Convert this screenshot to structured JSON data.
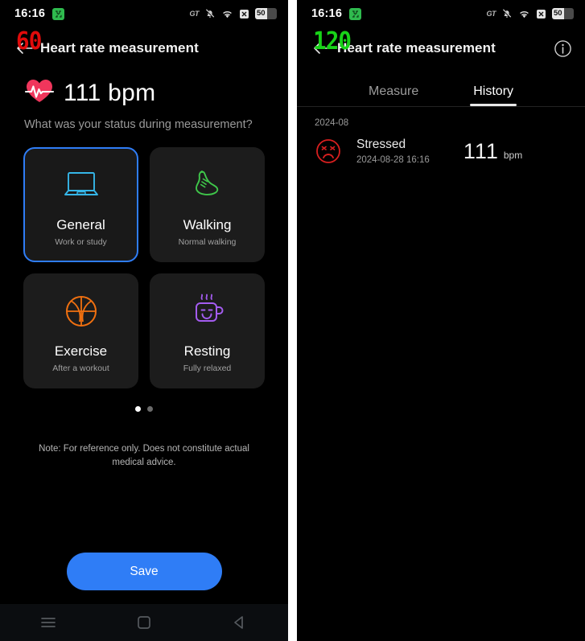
{
  "left": {
    "statusbar": {
      "time": "16:16",
      "badge_icon": "app-badge-icon",
      "carrier_label": "GT",
      "icons": [
        "bell-muted-icon",
        "wifi-icon",
        "sim-x-icon"
      ],
      "battery_level": "50"
    },
    "appbar": {
      "digital_readout": "60",
      "digital_color": "#e00b0b",
      "back_icon": "back-arrow-icon",
      "title": "Heart rate measurement"
    },
    "reading": {
      "heart_icon": "heart-pulse-icon",
      "value": "111 bpm",
      "question": "What was your status during measurement?"
    },
    "status_cards": [
      {
        "title": "General",
        "desc": "Work or study",
        "icon": "laptop-icon",
        "color": "#35b6e8",
        "selected": true
      },
      {
        "title": "Walking",
        "desc": "Normal walking",
        "icon": "shoe-icon",
        "color": "#3fc64a",
        "selected": false
      },
      {
        "title": "Exercise",
        "desc": "After a workout",
        "icon": "basketball-icon",
        "color": "#f07010",
        "selected": false
      },
      {
        "title": "Resting",
        "desc": "Fully relaxed",
        "icon": "coffee-cup-icon",
        "color": "#a45cf0",
        "selected": false
      }
    ],
    "pager": {
      "total": 2,
      "active_index": 0
    },
    "note": "Note: For reference only. Does not constitute actual medical advice.",
    "save_label": "Save",
    "navbar": [
      "recents-icon",
      "home-icon",
      "back-triangle-icon"
    ]
  },
  "right": {
    "statusbar": {
      "time": "16:16",
      "badge_icon": "app-badge-icon",
      "carrier_label": "GT",
      "icons": [
        "bell-muted-icon",
        "wifi-icon",
        "sim-x-icon"
      ],
      "battery_level": "50"
    },
    "appbar": {
      "digital_readout": "120",
      "digital_color": "#18d318",
      "back_icon": "back-arrow-icon",
      "title": "Heart rate measurement",
      "info_icon": "info-circle-icon"
    },
    "tabs": [
      {
        "label": "Measure",
        "active": false
      },
      {
        "label": "History",
        "active": true
      }
    ],
    "month_header": "2024-08",
    "history": [
      {
        "icon": "stressed-face-icon",
        "icon_color": "#d81f1f",
        "title": "Stressed",
        "timestamp": "2024-08-28 16:16",
        "value": "111",
        "unit": "bpm"
      }
    ]
  }
}
